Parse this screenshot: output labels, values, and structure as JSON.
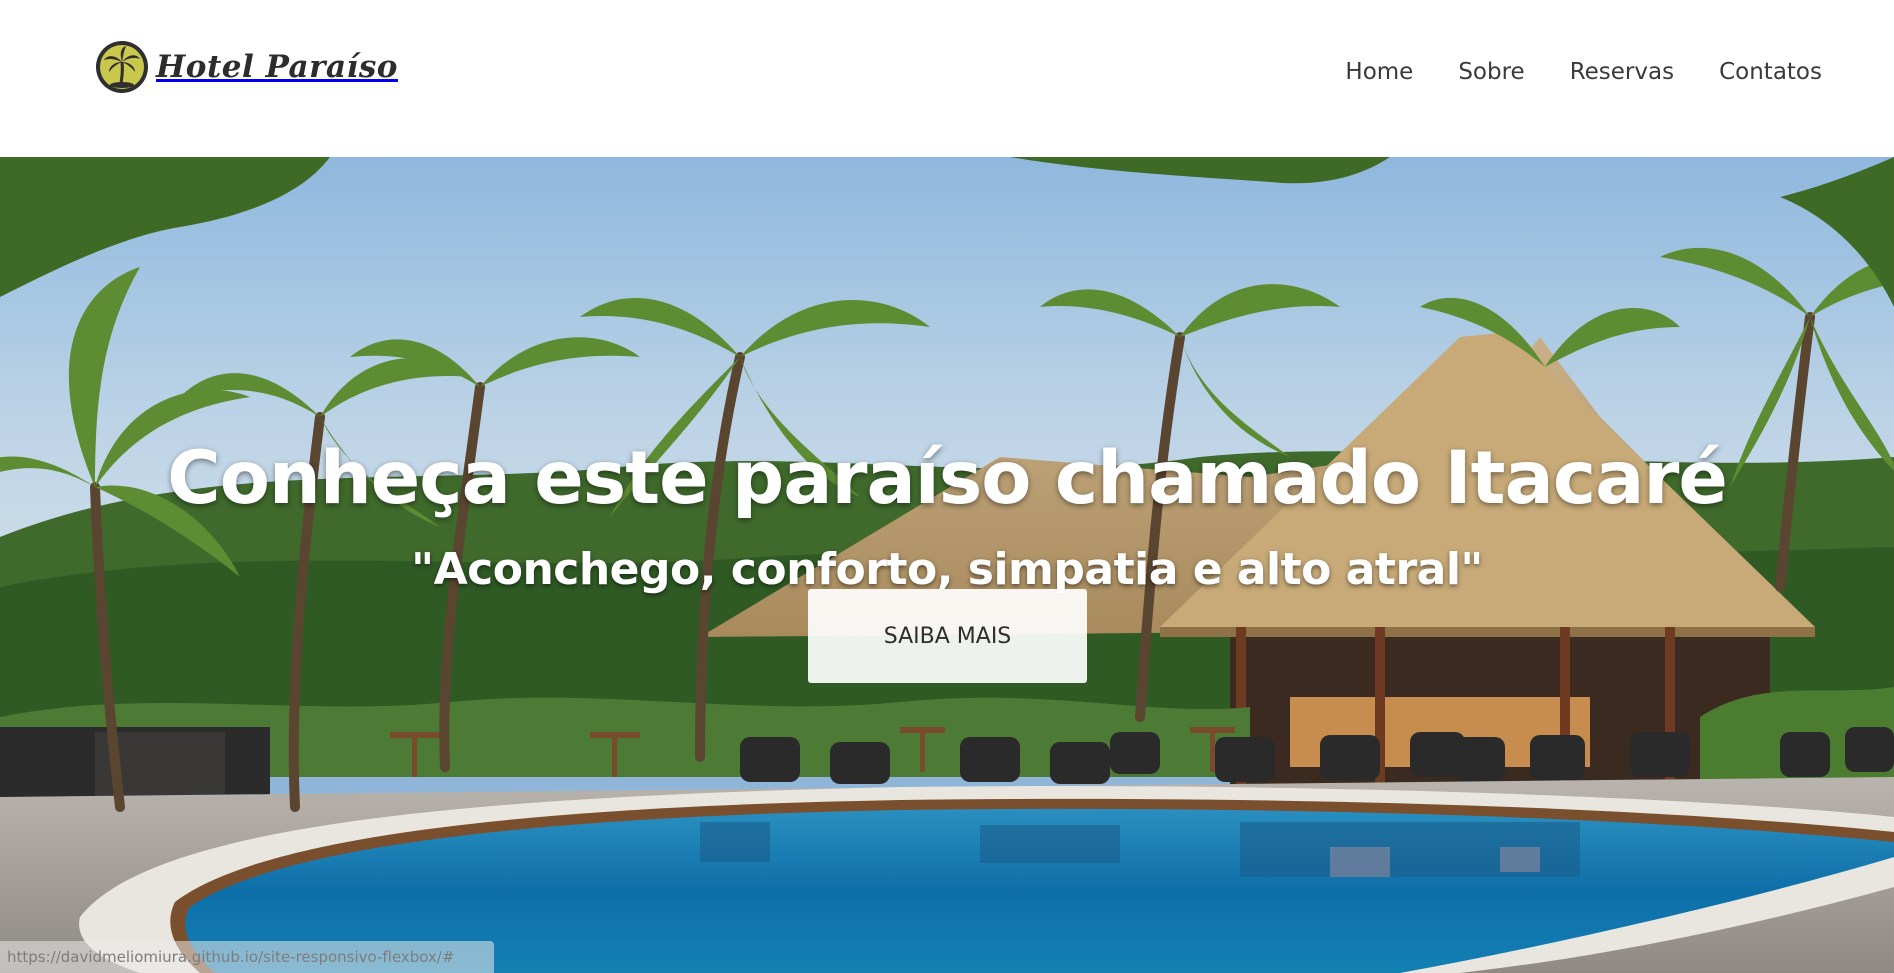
{
  "brand": {
    "name": "Hotel Paraíso",
    "logo_icon": "palm-tree-logo-icon",
    "logo_color": "#c9c84c"
  },
  "nav": {
    "items": [
      {
        "label": "Home"
      },
      {
        "label": "Sobre"
      },
      {
        "label": "Reservas"
      },
      {
        "label": "Contatos"
      }
    ]
  },
  "hero": {
    "title": "Conheça este paraíso chamado Itacaré",
    "subtitle": "\"Aconchego, conforto, simpatia e alto atral\"",
    "cta_label": "SAIBA MAIS",
    "background": "tropical resort pool with palm trees and thatched-roof bar"
  },
  "status_bar": {
    "url": "https://davidmeliomiura.github.io/site-responsivo-flexbox/#"
  }
}
